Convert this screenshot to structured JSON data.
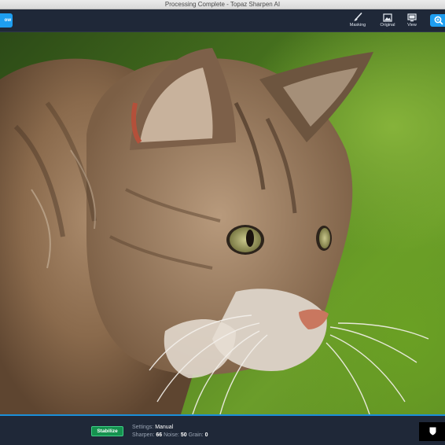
{
  "window": {
    "title": "Processing Complete - Topaz Sharpen AI"
  },
  "toolbar": {
    "left_button_label": "ow",
    "masking_label": "Masking",
    "original_label": "Original",
    "view_label": "View",
    "zoom_icon": "zoom-icon"
  },
  "canvas": {
    "image_subject": "tabby-cat-photo"
  },
  "bottom": {
    "stabilize_label": "Stabilize",
    "settings_label": "Settings:",
    "settings_value": "Manual",
    "sharpen_label": "Sharpen:",
    "sharpen_value": "66",
    "noise_label": "Noise:",
    "noise_value": "50",
    "grain_label": "Grain:",
    "grain_value": "0"
  },
  "colors": {
    "accent": "#1e9ef0",
    "stabilize": "#15924f",
    "toolbar_bg": "#1f2838"
  }
}
